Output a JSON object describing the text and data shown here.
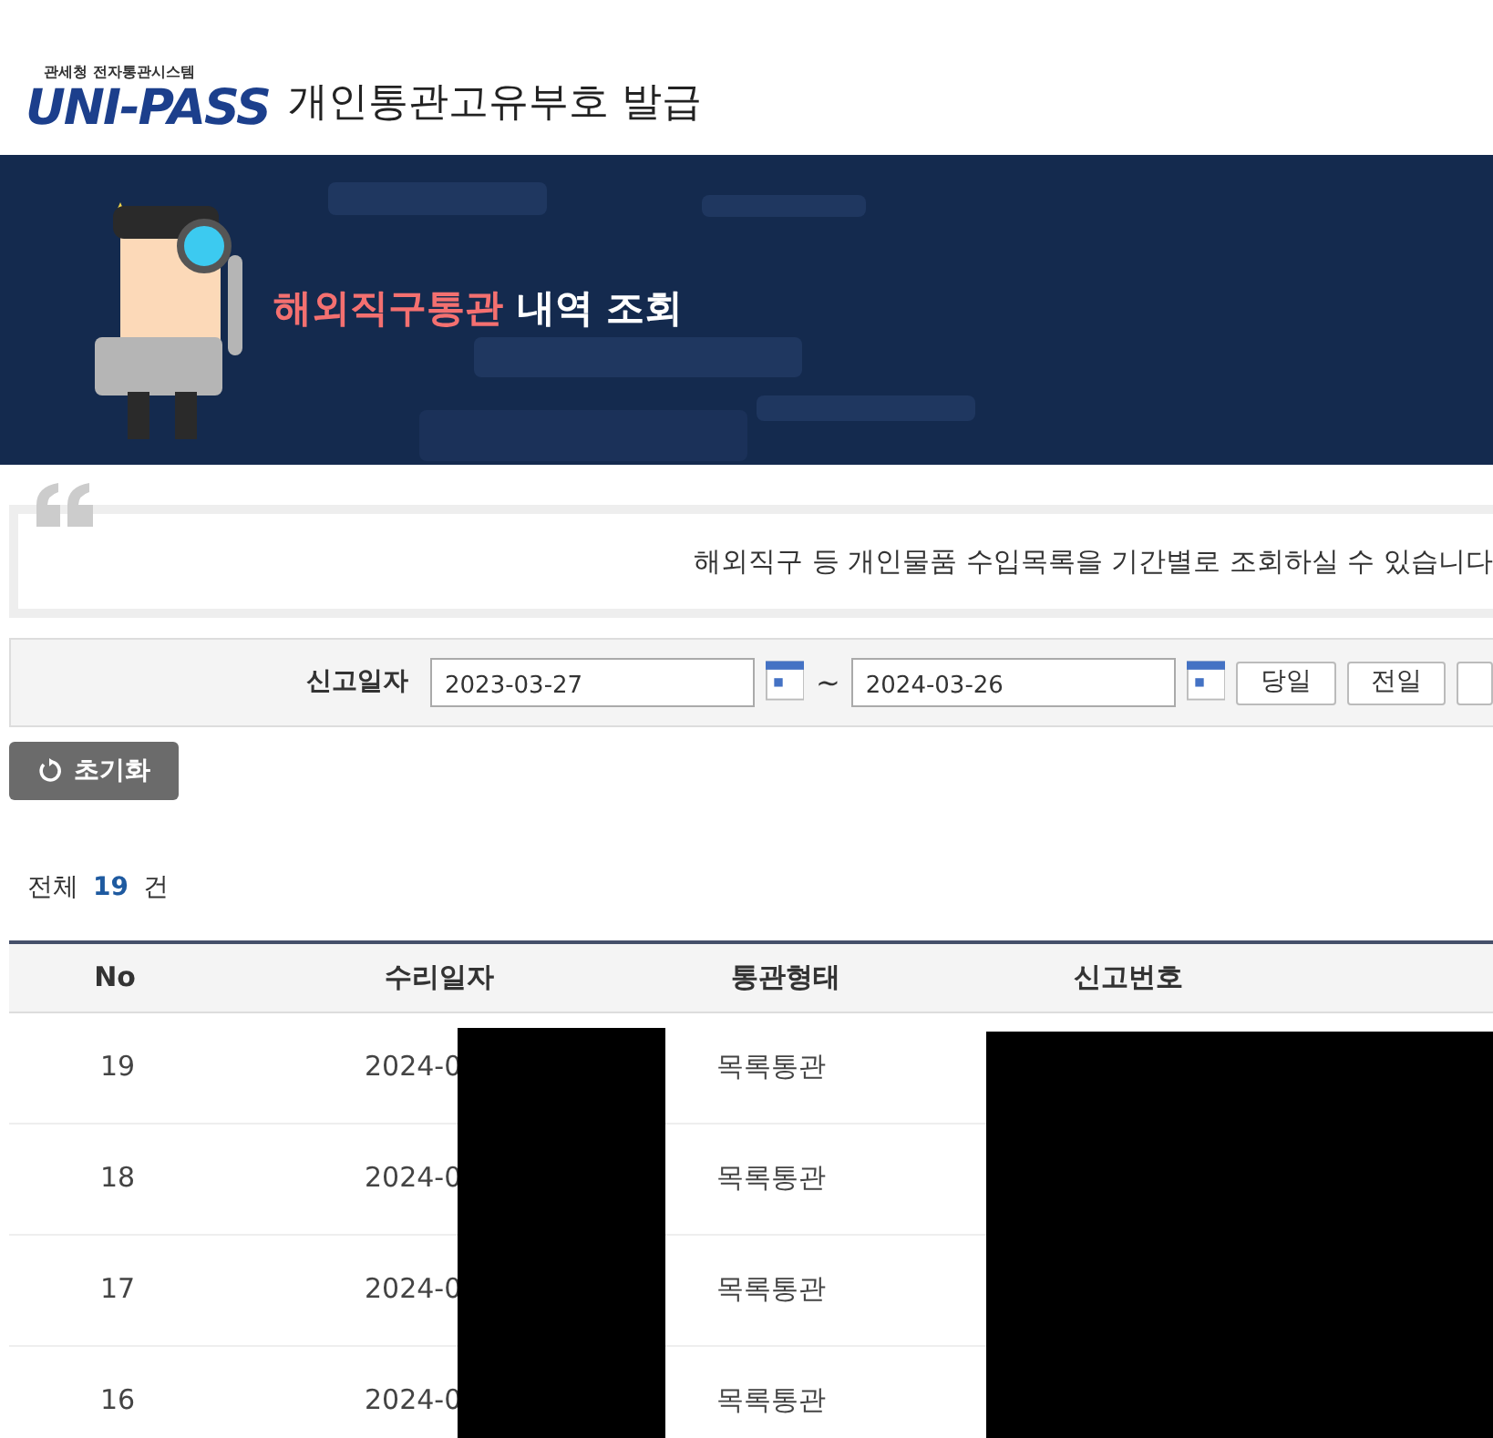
{
  "header": {
    "logo_caption": "관세청 전자통관시스템",
    "logo_text": "UNI-PASS",
    "title": "개인통관고유부호 발급"
  },
  "banner": {
    "kind": "picture",
    "title_highlight": "해외직구통관",
    "title_rest": "내역 조회"
  },
  "notice": {
    "text": "해외직구 등 개인물품 수입목록을 기간별로 조회하실 수 있습니다"
  },
  "search": {
    "label": "신고일자",
    "date_from": "2023-03-27",
    "separator": "~",
    "date_to": "2024-03-26",
    "period_buttons": [
      {
        "kind": "full",
        "label": "당일"
      },
      {
        "kind": "full",
        "label": "전일"
      },
      {
        "kind": "cut"
      }
    ]
  },
  "reset_button": "초기화",
  "total": {
    "prefix": "전체",
    "count": "19",
    "suffix": "건"
  },
  "table": {
    "columns": [
      "No",
      "수리일자",
      "통관형태",
      "신고번호"
    ],
    "rows": [
      {
        "no": "19",
        "date": "2024-0",
        "type": "목록통관"
      },
      {
        "no": "18",
        "date": "2024-0",
        "type": "목록통관"
      },
      {
        "no": "17",
        "date": "2024-0",
        "type": "목록통관"
      },
      {
        "no": "16",
        "date": "2024-0",
        "type": "목록통관"
      }
    ]
  }
}
